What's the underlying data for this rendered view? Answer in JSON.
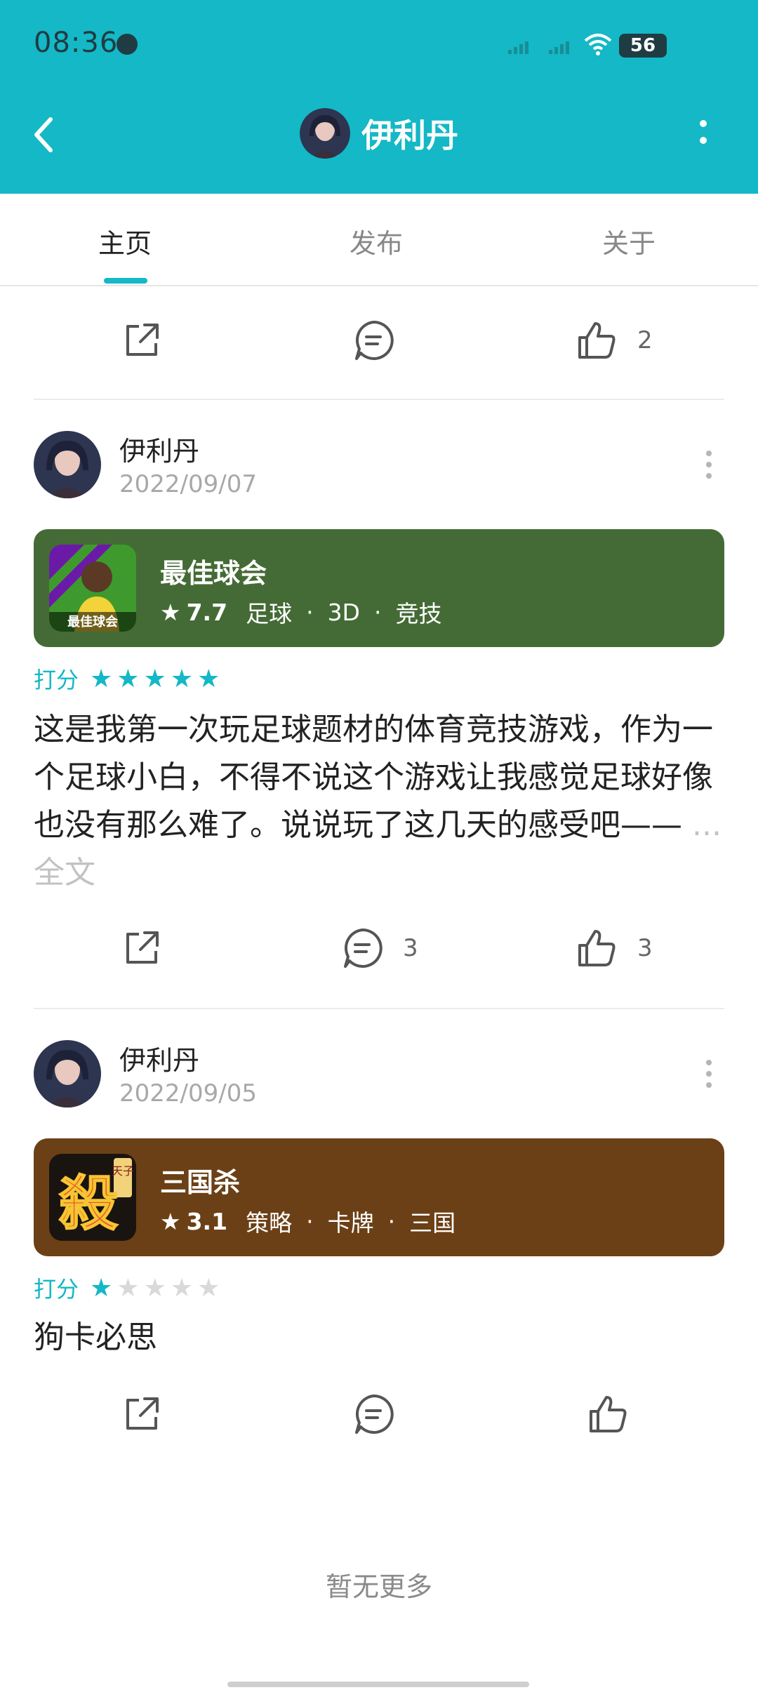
{
  "status": {
    "time": "08:36",
    "battery": "56"
  },
  "header": {
    "title": "伊利丹",
    "accent": "#14b8c6"
  },
  "tabs": [
    {
      "label": "主页"
    },
    {
      "label": "发布"
    },
    {
      "label": "关于"
    }
  ],
  "top_actions": {
    "like_count": "2"
  },
  "posts": [
    {
      "username": "伊利丹",
      "date": "2022/09/07",
      "game": {
        "name": "最佳球会",
        "score": "7.7",
        "tags": [
          "足球",
          "3D",
          "竞技"
        ],
        "icon_text": "最佳球会",
        "card_color": "#446b35"
      },
      "rating_label": "打分",
      "rating_stars": 5,
      "text": "这是我第一次玩足球题材的体育竞技游戏，作为一个足球小白，不得不说这个游戏让我感觉足球好像也没有那么难了。说说玩了这几天的感受吧——",
      "ellipsis": " ... ",
      "full_label": "全文",
      "comment_count": "3",
      "like_count": "3"
    },
    {
      "username": "伊利丹",
      "date": "2022/09/05",
      "game": {
        "name": "三国杀",
        "score": "3.1",
        "tags": [
          "策略",
          "卡牌",
          "三国"
        ],
        "icon_text": "殺",
        "icon_small": "天子",
        "card_color": "#6b4016"
      },
      "rating_label": "打分",
      "rating_stars": 1,
      "text": "狗卡必思",
      "comment_count": "",
      "like_count": ""
    }
  ],
  "footer": {
    "no_more": "暂无更多"
  },
  "icons": [
    "back-arrow-icon",
    "more-vertical-icon",
    "share-icon",
    "comment-icon",
    "like-icon",
    "star-icon"
  ]
}
